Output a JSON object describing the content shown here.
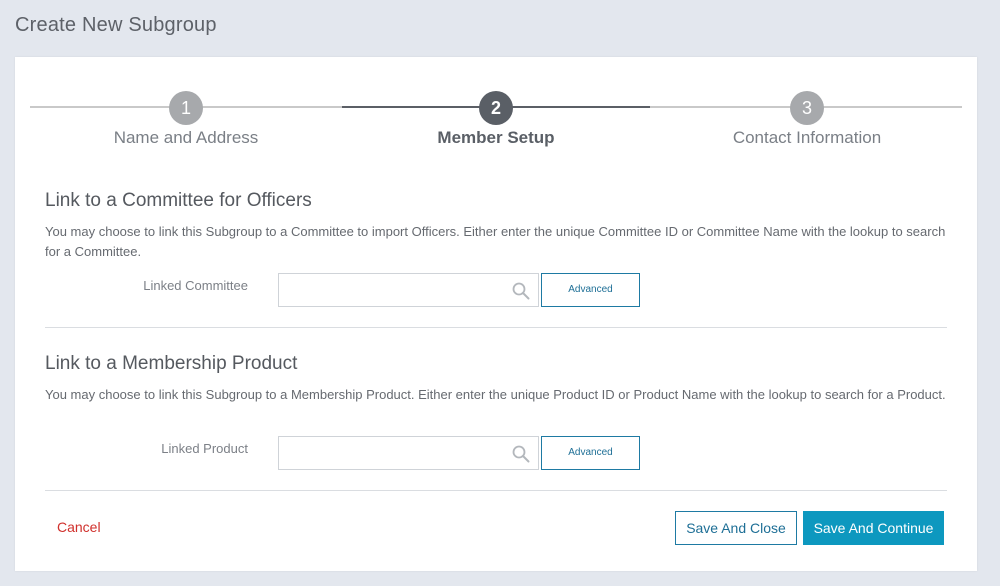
{
  "page": {
    "title": "Create New Subgroup"
  },
  "stepper": {
    "steps": [
      {
        "number": "1",
        "label": "Name and Address",
        "state": "inactive"
      },
      {
        "number": "2",
        "label": "Member Setup",
        "state": "active"
      },
      {
        "number": "3",
        "label": "Contact Information",
        "state": "inactive"
      }
    ]
  },
  "committee_section": {
    "title": "Link to a Committee for Officers",
    "description": "You may choose to link this Subgroup to a Committee to import Officers. Either enter the unique Committee ID or Committee Name with the lookup to search for a Committee.",
    "field_label": "Linked Committee",
    "field_value": "",
    "advanced_label": "Advanced"
  },
  "product_section": {
    "title": "Link to a Membership Product",
    "description": "You may choose to link this Subgroup to a Membership Product. Either enter the unique Product ID or Product Name with the lookup to search for a Product.",
    "field_label": "Linked Product",
    "field_value": "",
    "advanced_label": "Advanced"
  },
  "footer": {
    "cancel_label": "Cancel",
    "save_close_label": "Save And Close",
    "save_continue_label": "Save And Continue"
  },
  "colors": {
    "background": "#e3e7ee",
    "accent": "#0d98bf",
    "cancel": "#d0302c",
    "step_active": "#5a5f66",
    "step_inactive": "#a7a9ac"
  },
  "icons": [
    "search-icon"
  ]
}
